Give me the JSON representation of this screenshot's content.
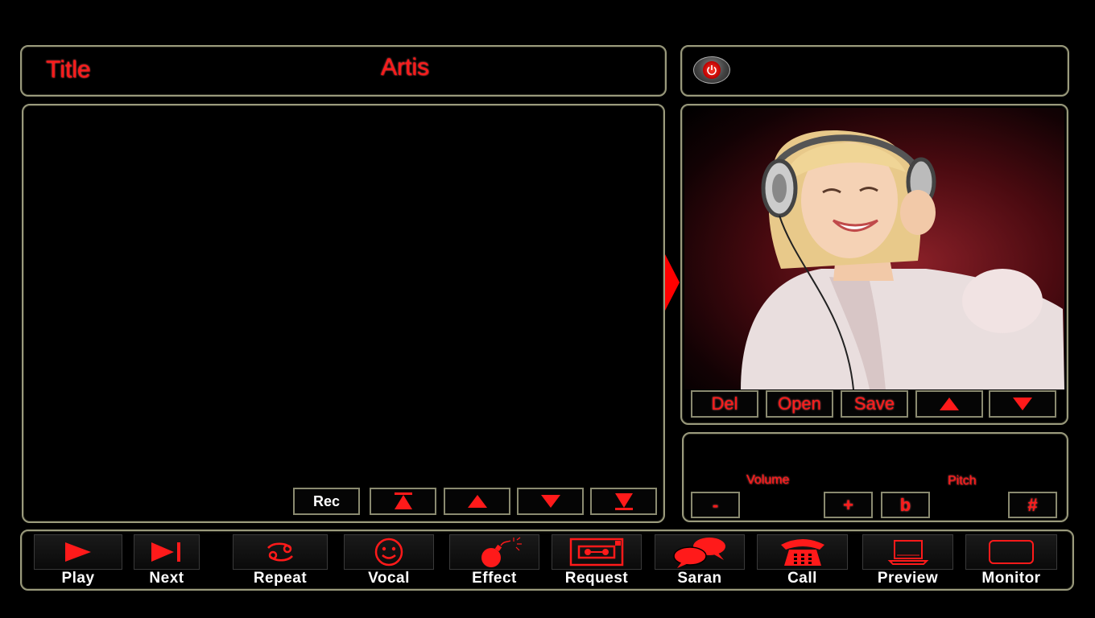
{
  "header": {
    "title_label": "Title",
    "artist_label": "Artis"
  },
  "right_top": {
    "power_icon": "power-icon"
  },
  "playlist_controls": {
    "rec_label": "Rec"
  },
  "photo_controls": {
    "del_label": "Del",
    "open_label": "Open",
    "save_label": "Save"
  },
  "audio": {
    "volume_label": "Volume",
    "pitch_label": "Pitch",
    "minus_label": "-",
    "plus_label": "+",
    "flat_label": "b",
    "sharp_label": "#"
  },
  "toolbar": {
    "items": [
      {
        "label": "Play",
        "icon": "play-icon"
      },
      {
        "label": "Next",
        "icon": "next-icon"
      },
      {
        "label": "Repeat",
        "icon": "repeat-icon"
      },
      {
        "label": "Vocal",
        "icon": "smiley-icon"
      },
      {
        "label": "Effect",
        "icon": "bomb-icon"
      },
      {
        "label": "Request",
        "icon": "cassette-icon"
      },
      {
        "label": "Saran",
        "icon": "chat-bubbles-icon"
      },
      {
        "label": "Call",
        "icon": "telephone-icon"
      },
      {
        "label": "Preview",
        "icon": "laptop-icon"
      },
      {
        "label": "Monitor",
        "icon": "monitor-icon"
      }
    ]
  },
  "colors": {
    "accent": "#ff1a1a",
    "border": "#9a9a7c",
    "background": "#000000"
  }
}
